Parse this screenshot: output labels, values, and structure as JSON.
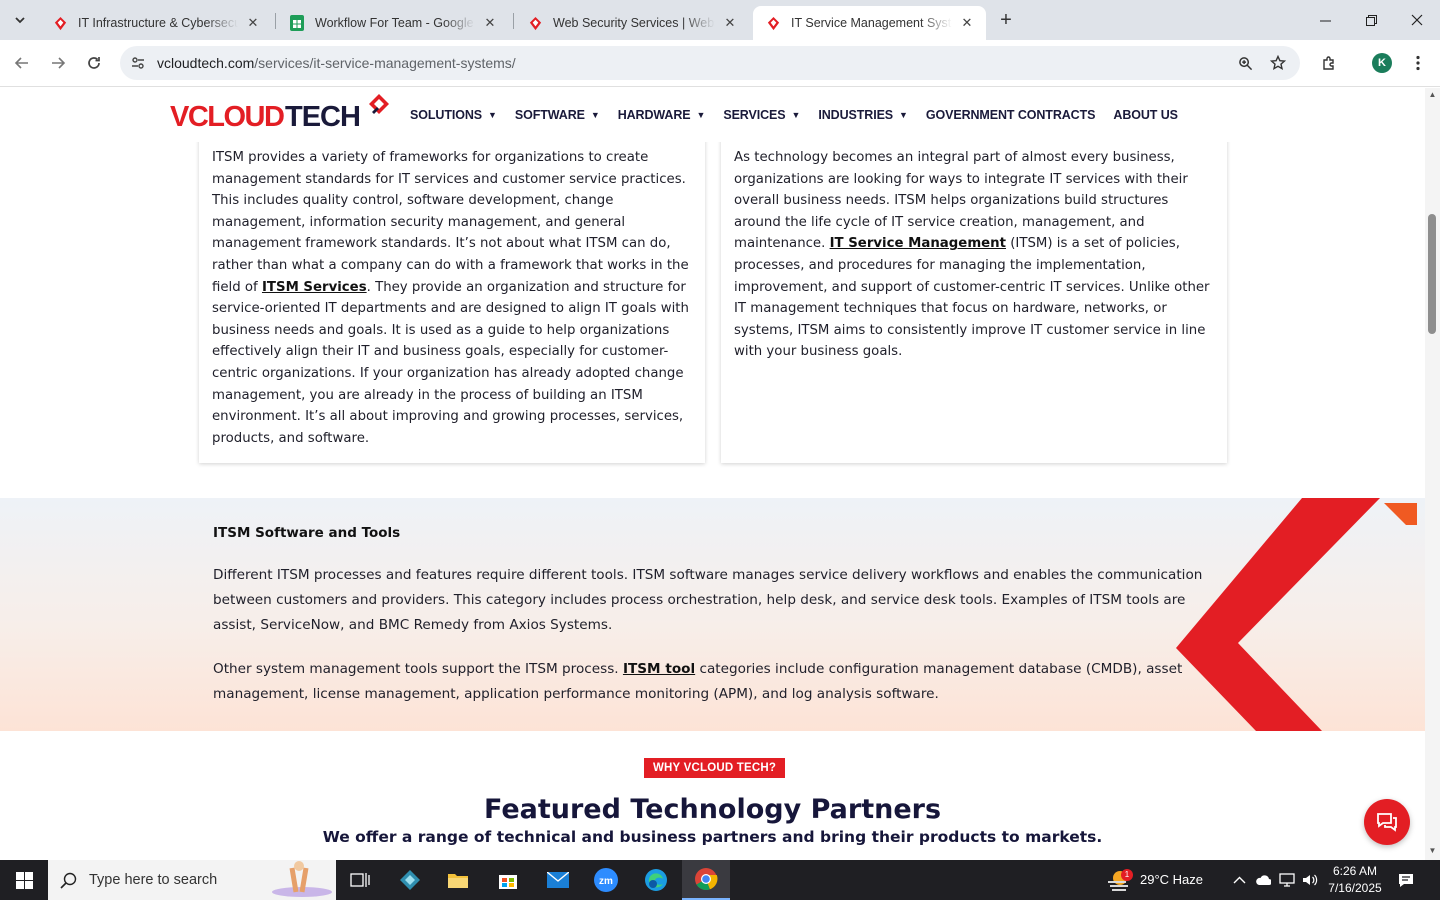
{
  "browser": {
    "tabs": [
      {
        "title": "IT Infrastructure & Cybersecurity",
        "active": false,
        "favicon": "vcloud-logo-icon"
      },
      {
        "title": "Workflow For Team - Google Sheets",
        "active": false,
        "favicon": "google-sheets-icon"
      },
      {
        "title": "Web Security Services | Website",
        "active": false,
        "favicon": "vcloud-logo-icon"
      },
      {
        "title": "IT Service Management Systems",
        "active": true,
        "favicon": "vcloud-logo-icon"
      }
    ],
    "url_host": "vcloudtech.com",
    "url_path": "/services/it-service-management-systems/",
    "profile_initial": "K"
  },
  "site": {
    "logo_text_1": "VCLOUD",
    "logo_text_2": "TECH",
    "nav": [
      {
        "label": "SOLUTIONS",
        "dropdown": true
      },
      {
        "label": "SOFTWARE",
        "dropdown": true
      },
      {
        "label": "HARDWARE",
        "dropdown": true
      },
      {
        "label": "SERVICES",
        "dropdown": true
      },
      {
        "label": "INDUSTRIES",
        "dropdown": true
      },
      {
        "label": "GOVERNMENT CONTRACTS",
        "dropdown": false
      },
      {
        "label": "ABOUT US",
        "dropdown": false
      }
    ]
  },
  "cards": {
    "left": {
      "text_a": "ITSM provides a variety of frameworks for organizations to create management standards for IT services and customer service practices. This includes quality control, software development, change management, information security management, and general management framework standards. It’s not about what ITSM can do, rather than what a company can do with a framework that works in the field of ",
      "link": "ITSM Services",
      "text_b": ". They provide an organization and structure for service-oriented IT departments and are designed to align IT goals with business needs and goals. It is used as a guide to help organizations effectively align their IT and business goals, especially for customer-centric organizations. If your organization has already adopted change management, you are already in the process of building an ITSM environment. It’s all about improving and growing processes, services, products, and software."
    },
    "right": {
      "text_a": "As technology becomes an integral part of almost every business, organizations are looking for ways to integrate IT services with their overall business needs. ITSM helps organizations build structures around the life cycle of IT service creation, management, and maintenance. ",
      "link": "IT Service Management",
      "text_b": " (ITSM) is a set of policies, processes, and procedures for managing the implementation, improvement, and support of customer-centric IT services. Unlike other IT management techniques that focus on hardware, networks, or systems, ITSM aims to consistently improve IT customer service in line with your business goals."
    }
  },
  "tools_section": {
    "heading": "ITSM Software and Tools",
    "para1": "Different ITSM processes and features require different tools. ITSM software manages service delivery workflows and enables the communication between customers and providers. This category includes process orchestration, help desk, and service desk tools. Examples of ITSM tools are assist, ServiceNow, and BMC Remedy from Axios Systems.",
    "para2_a": "Other system management tools support the ITSM process. ",
    "para2_link": "ITSM tool",
    "para2_b": " categories include configuration management database (CMDB), asset management, license management, application performance monitoring (APM), and log analysis software."
  },
  "partners": {
    "badge": "WHY VCLOUD TECH?",
    "title": "Featured Technology Partners",
    "subtitle": "We offer a range of technical and business partners and bring their products to markets."
  },
  "taskbar": {
    "search_placeholder": "Type here to search",
    "weather": "29°C  Haze",
    "weather_badge": "1",
    "time": "6:26 AM",
    "date": "7/16/2025"
  },
  "colors": {
    "brand_red": "#e31e24",
    "navy": "#16163a"
  }
}
